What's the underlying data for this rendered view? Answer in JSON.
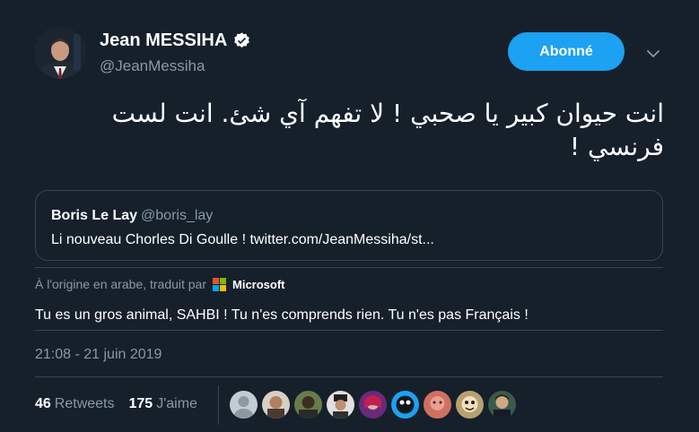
{
  "author": {
    "display_name": "Jean MESSIHA",
    "handle": "@JeanMessiha",
    "verified_icon": "verified-badge-icon"
  },
  "follow_button": {
    "label": "Abonné"
  },
  "menu": {
    "icon": "chevron-down-icon"
  },
  "tweet": {
    "arabic_text": "انت حيوان كبير يا صحبي ! لا تفهم آي شئ. انت لست فرنسي !"
  },
  "quoted_tweet": {
    "name": "Boris Le Lay",
    "handle": "@boris_lay",
    "text": "Li nouveau Chorles Di Goulle ! twitter.com/JeanMessiha/st..."
  },
  "translation": {
    "note": "À l'origine en arabe, traduit par",
    "provider": "Microsoft",
    "text": "Tu es un gros animal, SAHBI ! Tu n'es comprends rien. Tu n'es pas Français !"
  },
  "timestamp": "21:08 - 21 juin 2019",
  "stats": {
    "retweets_count": "46",
    "retweets_label": "Retweets",
    "likes_count": "175",
    "likes_label": "J'aime"
  },
  "colors": {
    "background": "#15202b",
    "accent": "#1da1f2",
    "secondary_text": "#8899a6",
    "border": "#38444d"
  }
}
